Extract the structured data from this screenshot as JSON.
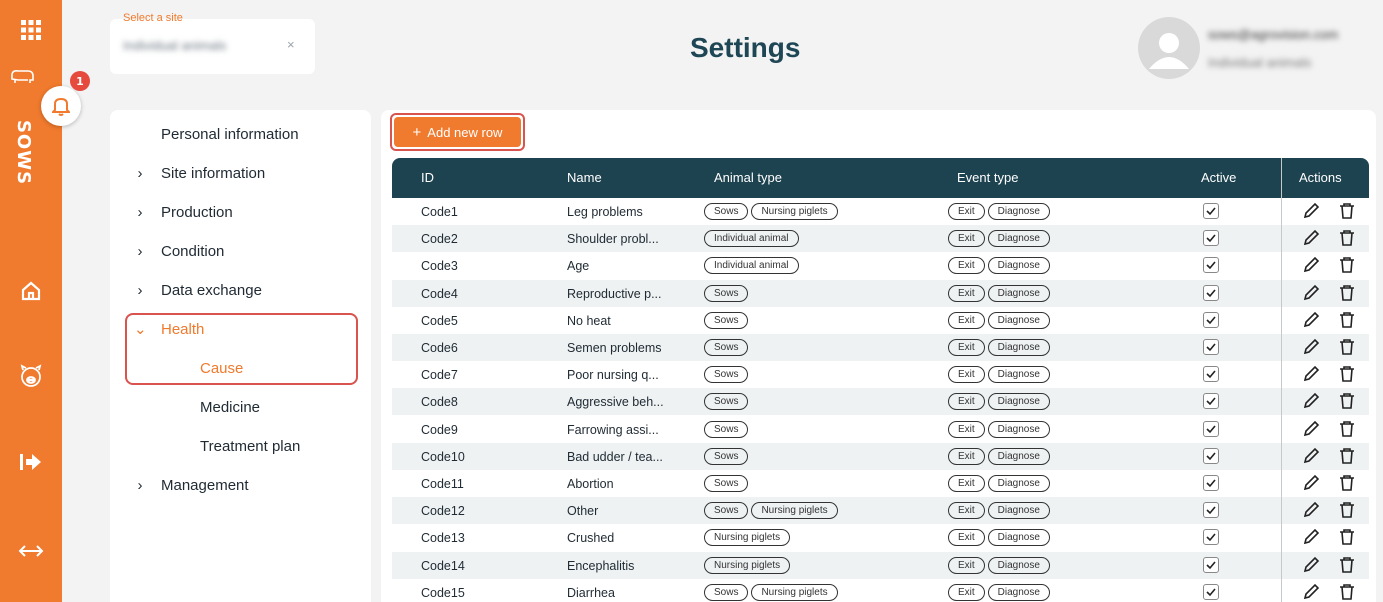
{
  "sidebar": {
    "brand": "SOWS",
    "notification_count": "1"
  },
  "site_select": {
    "label": "Select a site",
    "value": "Individual animals",
    "clear": "×"
  },
  "header": {
    "title": "Settings"
  },
  "user": {
    "email": "sows@agrovision.com",
    "site": "Individual animals"
  },
  "nav": {
    "items": [
      {
        "label": "Personal information",
        "chevron": ""
      },
      {
        "label": "Site information",
        "chevron": "›"
      },
      {
        "label": "Production",
        "chevron": "›"
      },
      {
        "label": "Condition",
        "chevron": "›"
      },
      {
        "label": "Data exchange",
        "chevron": "›"
      },
      {
        "label": "Health",
        "chevron": "⌄"
      },
      {
        "label": "Cause",
        "chevron": ""
      },
      {
        "label": "Medicine",
        "chevron": ""
      },
      {
        "label": "Treatment plan",
        "chevron": ""
      },
      {
        "label": "Management",
        "chevron": "›"
      }
    ]
  },
  "toolbar": {
    "add_label": "Add new row"
  },
  "table": {
    "columns": {
      "id": "ID",
      "name": "Name",
      "animal": "Animal type",
      "event": "Event type",
      "active": "Active",
      "actions": "Actions"
    },
    "rows": [
      {
        "id": "Code1",
        "name": "Leg problems",
        "animal": [
          "Sows",
          "Nursing piglets"
        ],
        "event": [
          "Exit",
          "Diagnose"
        ]
      },
      {
        "id": "Code2",
        "name": "Shoulder probl...",
        "animal": [
          "Individual animal"
        ],
        "event": [
          "Exit",
          "Diagnose"
        ]
      },
      {
        "id": "Code3",
        "name": "Age",
        "animal": [
          "Individual animal"
        ],
        "event": [
          "Exit",
          "Diagnose"
        ]
      },
      {
        "id": "Code4",
        "name": "Reproductive p...",
        "animal": [
          "Sows"
        ],
        "event": [
          "Exit",
          "Diagnose"
        ]
      },
      {
        "id": "Code5",
        "name": "No heat",
        "animal": [
          "Sows"
        ],
        "event": [
          "Exit",
          "Diagnose"
        ]
      },
      {
        "id": "Code6",
        "name": "Semen problems",
        "animal": [
          "Sows"
        ],
        "event": [
          "Exit",
          "Diagnose"
        ]
      },
      {
        "id": "Code7",
        "name": "Poor nursing q...",
        "animal": [
          "Sows"
        ],
        "event": [
          "Exit",
          "Diagnose"
        ]
      },
      {
        "id": "Code8",
        "name": "Aggressive beh...",
        "animal": [
          "Sows"
        ],
        "event": [
          "Exit",
          "Diagnose"
        ]
      },
      {
        "id": "Code9",
        "name": "Farrowing assi...",
        "animal": [
          "Sows"
        ],
        "event": [
          "Exit",
          "Diagnose"
        ]
      },
      {
        "id": "Code10",
        "name": "Bad udder / tea...",
        "animal": [
          "Sows"
        ],
        "event": [
          "Exit",
          "Diagnose"
        ]
      },
      {
        "id": "Code11",
        "name": "Abortion",
        "animal": [
          "Sows"
        ],
        "event": [
          "Exit",
          "Diagnose"
        ]
      },
      {
        "id": "Code12",
        "name": "Other",
        "animal": [
          "Sows",
          "Nursing piglets"
        ],
        "event": [
          "Exit",
          "Diagnose"
        ]
      },
      {
        "id": "Code13",
        "name": "Crushed",
        "animal": [
          "Nursing piglets"
        ],
        "event": [
          "Exit",
          "Diagnose"
        ]
      },
      {
        "id": "Code14",
        "name": "Encephalitis",
        "animal": [
          "Nursing piglets"
        ],
        "event": [
          "Exit",
          "Diagnose"
        ]
      },
      {
        "id": "Code15",
        "name": "Diarrhea",
        "animal": [
          "Sows",
          "Nursing piglets"
        ],
        "event": [
          "Exit",
          "Diagnose"
        ]
      }
    ]
  },
  "colors": {
    "accent": "#f07a2d",
    "header": "#1d4250",
    "highlight": "#d9534f"
  }
}
